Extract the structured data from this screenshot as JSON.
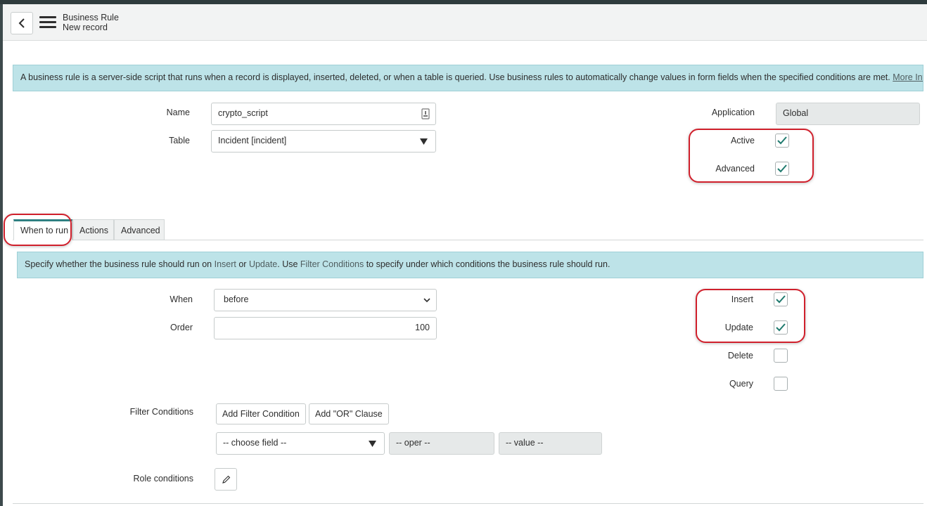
{
  "header": {
    "title": "Business Rule",
    "subtitle": "New record"
  },
  "info_banner": {
    "text": "A business rule is a server-side script that runs when a record is displayed, inserted, deleted, or when a table is queried. Use business rules to automatically change values in form fields when the specified conditions are met.",
    "link": "More Info"
  },
  "form": {
    "name": {
      "label": "Name",
      "value": "crypto_script"
    },
    "table": {
      "label": "Table",
      "value": "Incident [incident]"
    },
    "application": {
      "label": "Application",
      "value": "Global"
    },
    "active": {
      "label": "Active",
      "checked": true
    },
    "advanced": {
      "label": "Advanced",
      "checked": true
    }
  },
  "tabs": [
    {
      "label": "When to run",
      "active": true
    },
    {
      "label": "Actions",
      "active": false
    },
    {
      "label": "Advanced",
      "active": false
    }
  ],
  "when_to_run": {
    "banner": {
      "prefix": "Specify whether the business rule should run on ",
      "insert": "Insert",
      "or": " or ",
      "update": "Update",
      "mid": ". Use ",
      "filter": "Filter Conditions",
      "suffix": " to specify under which conditions the business rule should run."
    },
    "when": {
      "label": "When",
      "value": "before"
    },
    "order": {
      "label": "Order",
      "value": "100"
    },
    "insert": {
      "label": "Insert",
      "checked": true
    },
    "update": {
      "label": "Update",
      "checked": true
    },
    "delete": {
      "label": "Delete",
      "checked": false
    },
    "query": {
      "label": "Query",
      "checked": false
    },
    "filter_conditions": {
      "label": "Filter Conditions",
      "add_condition": "Add Filter Condition",
      "add_or": "Add \"OR\" Clause",
      "field": "-- choose field --",
      "oper": "-- oper --",
      "value": "-- value --"
    },
    "role_conditions": {
      "label": "Role conditions"
    }
  },
  "colors": {
    "accent": "#2e8082",
    "banner": "#bde3e8",
    "annotation": "#d0202c"
  }
}
